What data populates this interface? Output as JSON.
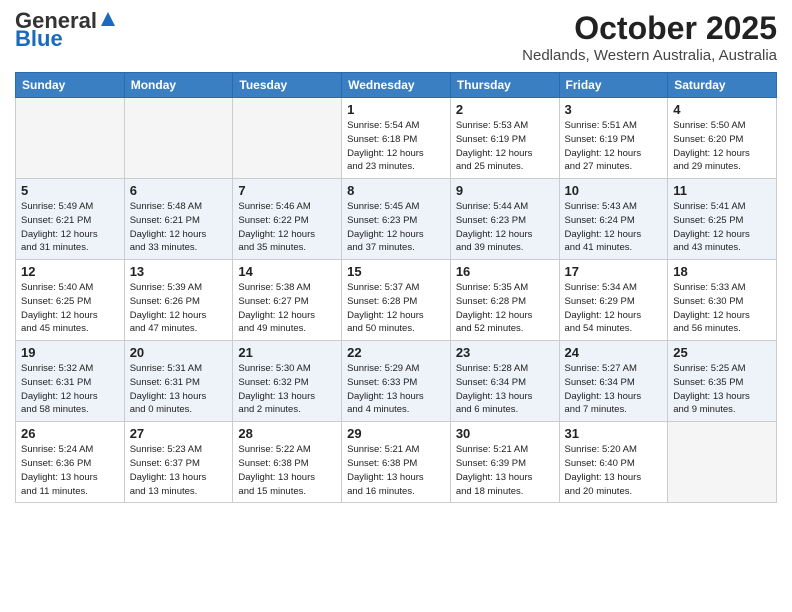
{
  "header": {
    "logo_general": "General",
    "logo_blue": "Blue",
    "month": "October 2025",
    "location": "Nedlands, Western Australia, Australia"
  },
  "weekdays": [
    "Sunday",
    "Monday",
    "Tuesday",
    "Wednesday",
    "Thursday",
    "Friday",
    "Saturday"
  ],
  "weeks": [
    [
      {
        "day": "",
        "detail": ""
      },
      {
        "day": "",
        "detail": ""
      },
      {
        "day": "",
        "detail": ""
      },
      {
        "day": "1",
        "detail": "Sunrise: 5:54 AM\nSunset: 6:18 PM\nDaylight: 12 hours\nand 23 minutes."
      },
      {
        "day": "2",
        "detail": "Sunrise: 5:53 AM\nSunset: 6:19 PM\nDaylight: 12 hours\nand 25 minutes."
      },
      {
        "day": "3",
        "detail": "Sunrise: 5:51 AM\nSunset: 6:19 PM\nDaylight: 12 hours\nand 27 minutes."
      },
      {
        "day": "4",
        "detail": "Sunrise: 5:50 AM\nSunset: 6:20 PM\nDaylight: 12 hours\nand 29 minutes."
      }
    ],
    [
      {
        "day": "5",
        "detail": "Sunrise: 5:49 AM\nSunset: 6:21 PM\nDaylight: 12 hours\nand 31 minutes."
      },
      {
        "day": "6",
        "detail": "Sunrise: 5:48 AM\nSunset: 6:21 PM\nDaylight: 12 hours\nand 33 minutes."
      },
      {
        "day": "7",
        "detail": "Sunrise: 5:46 AM\nSunset: 6:22 PM\nDaylight: 12 hours\nand 35 minutes."
      },
      {
        "day": "8",
        "detail": "Sunrise: 5:45 AM\nSunset: 6:23 PM\nDaylight: 12 hours\nand 37 minutes."
      },
      {
        "day": "9",
        "detail": "Sunrise: 5:44 AM\nSunset: 6:23 PM\nDaylight: 12 hours\nand 39 minutes."
      },
      {
        "day": "10",
        "detail": "Sunrise: 5:43 AM\nSunset: 6:24 PM\nDaylight: 12 hours\nand 41 minutes."
      },
      {
        "day": "11",
        "detail": "Sunrise: 5:41 AM\nSunset: 6:25 PM\nDaylight: 12 hours\nand 43 minutes."
      }
    ],
    [
      {
        "day": "12",
        "detail": "Sunrise: 5:40 AM\nSunset: 6:25 PM\nDaylight: 12 hours\nand 45 minutes."
      },
      {
        "day": "13",
        "detail": "Sunrise: 5:39 AM\nSunset: 6:26 PM\nDaylight: 12 hours\nand 47 minutes."
      },
      {
        "day": "14",
        "detail": "Sunrise: 5:38 AM\nSunset: 6:27 PM\nDaylight: 12 hours\nand 49 minutes."
      },
      {
        "day": "15",
        "detail": "Sunrise: 5:37 AM\nSunset: 6:28 PM\nDaylight: 12 hours\nand 50 minutes."
      },
      {
        "day": "16",
        "detail": "Sunrise: 5:35 AM\nSunset: 6:28 PM\nDaylight: 12 hours\nand 52 minutes."
      },
      {
        "day": "17",
        "detail": "Sunrise: 5:34 AM\nSunset: 6:29 PM\nDaylight: 12 hours\nand 54 minutes."
      },
      {
        "day": "18",
        "detail": "Sunrise: 5:33 AM\nSunset: 6:30 PM\nDaylight: 12 hours\nand 56 minutes."
      }
    ],
    [
      {
        "day": "19",
        "detail": "Sunrise: 5:32 AM\nSunset: 6:31 PM\nDaylight: 12 hours\nand 58 minutes."
      },
      {
        "day": "20",
        "detail": "Sunrise: 5:31 AM\nSunset: 6:31 PM\nDaylight: 13 hours\nand 0 minutes."
      },
      {
        "day": "21",
        "detail": "Sunrise: 5:30 AM\nSunset: 6:32 PM\nDaylight: 13 hours\nand 2 minutes."
      },
      {
        "day": "22",
        "detail": "Sunrise: 5:29 AM\nSunset: 6:33 PM\nDaylight: 13 hours\nand 4 minutes."
      },
      {
        "day": "23",
        "detail": "Sunrise: 5:28 AM\nSunset: 6:34 PM\nDaylight: 13 hours\nand 6 minutes."
      },
      {
        "day": "24",
        "detail": "Sunrise: 5:27 AM\nSunset: 6:34 PM\nDaylight: 13 hours\nand 7 minutes."
      },
      {
        "day": "25",
        "detail": "Sunrise: 5:25 AM\nSunset: 6:35 PM\nDaylight: 13 hours\nand 9 minutes."
      }
    ],
    [
      {
        "day": "26",
        "detail": "Sunrise: 5:24 AM\nSunset: 6:36 PM\nDaylight: 13 hours\nand 11 minutes."
      },
      {
        "day": "27",
        "detail": "Sunrise: 5:23 AM\nSunset: 6:37 PM\nDaylight: 13 hours\nand 13 minutes."
      },
      {
        "day": "28",
        "detail": "Sunrise: 5:22 AM\nSunset: 6:38 PM\nDaylight: 13 hours\nand 15 minutes."
      },
      {
        "day": "29",
        "detail": "Sunrise: 5:21 AM\nSunset: 6:38 PM\nDaylight: 13 hours\nand 16 minutes."
      },
      {
        "day": "30",
        "detail": "Sunrise: 5:21 AM\nSunset: 6:39 PM\nDaylight: 13 hours\nand 18 minutes."
      },
      {
        "day": "31",
        "detail": "Sunrise: 5:20 AM\nSunset: 6:40 PM\nDaylight: 13 hours\nand 20 minutes."
      },
      {
        "day": "",
        "detail": ""
      }
    ]
  ]
}
